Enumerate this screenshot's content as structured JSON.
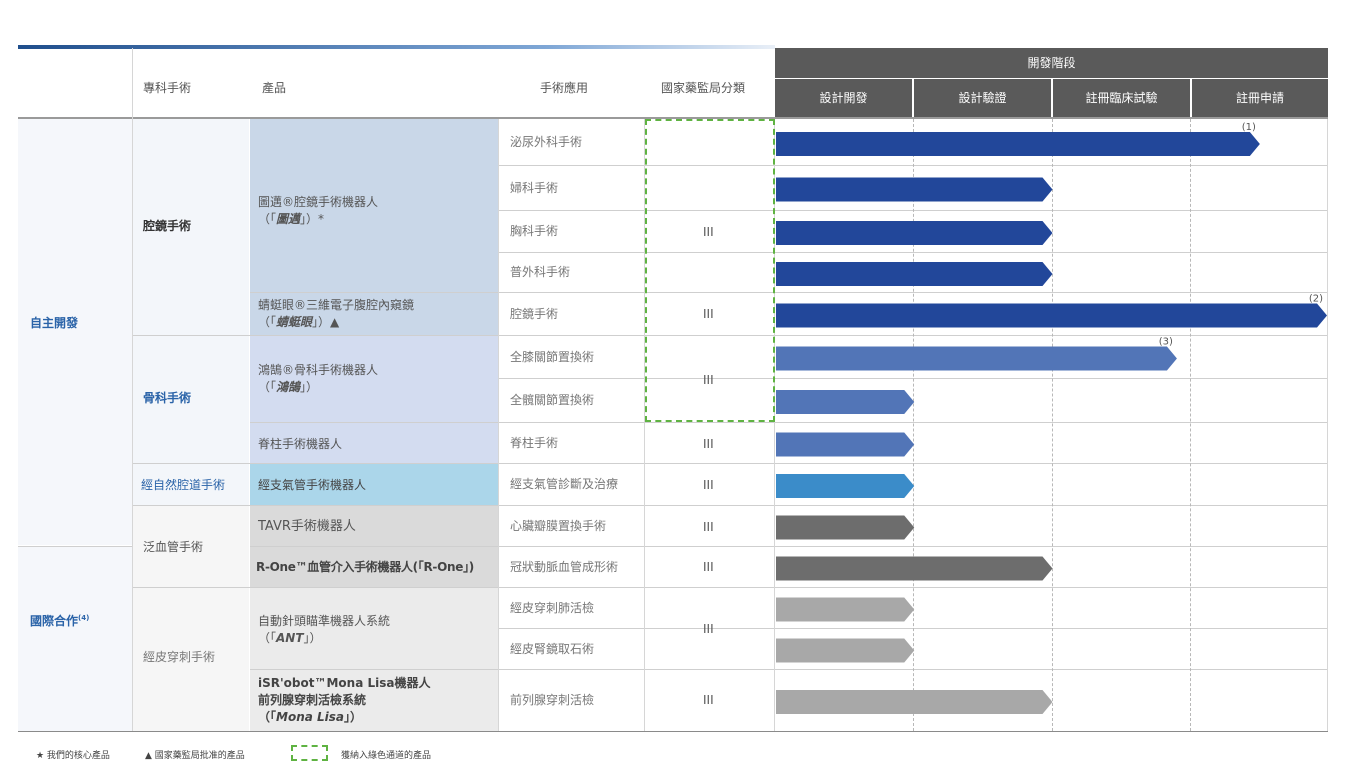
{
  "header": {
    "col_specialty": "專科手術",
    "col_product": "產品",
    "col_application": "手術應用",
    "col_nmpa": "國家藥監局分類",
    "dev_stage": "開發階段",
    "phases": [
      "設計開發",
      "設計驗證",
      "註冊臨床試驗",
      "註冊申請"
    ]
  },
  "groups": {
    "independent": "自主開發",
    "international": "國際合作",
    "international_sup": "(4)"
  },
  "specialties": {
    "laparoscopic": "腔鏡手術",
    "orthopedic": "骨科手術",
    "natural_orifice": "經自然腔道手術",
    "pan_vascular": "泛血管手術",
    "percutaneous": "經皮穿刺手術"
  },
  "products": {
    "p1_line1": "圖邁®腔鏡手術機器人",
    "p1_line2": "（「",
    "p1_name": "圖邁",
    "p1_line2_end": "」）*",
    "p2_line1": "蜻蜓眼®三維電子腹腔內窺鏡",
    "p2_line2": "（「",
    "p2_name": "蜻蜓眼",
    "p2_line2_end": "」）▲",
    "p3_line1": "鴻鵠®骨科手術機器人",
    "p3_line2": "（「",
    "p3_name": "鴻鵠",
    "p3_line2_end": "」）",
    "p4": "脊柱手術機器人",
    "p5": "經支氣管手術機器人",
    "p6": "TAVR手術機器人",
    "p7": "R-One™血管介入手術機器人(「R-One」)",
    "p8_line1": "自動針頭瞄準機器人系統",
    "p8_line2": "（「",
    "p8_name": "ANT",
    "p8_line2_end": "」）",
    "p9_line1": "iSR'obot™Mona Lisa機器人",
    "p9_line2": "前列腺穿刺活檢系統",
    "p9_line3": "（「",
    "p9_name": "Mona Lisa",
    "p9_line3_end": "」）"
  },
  "applications": [
    "泌尿外科手術",
    "婦科手術",
    "胸科手術",
    "普外科手術",
    "腔鏡手術",
    "全膝關節置換術",
    "全髖關節置換術",
    "脊柱手術",
    "經支氣管診斷及治療",
    "心臟瓣膜置換手術",
    "冠狀動脈血管成形術",
    "經皮穿刺肺活檢",
    "經皮腎鏡取石術",
    "前列腺穿刺活檢"
  ],
  "nmpa_class": "III",
  "chart_data": {
    "type": "gantt",
    "phases": [
      "設計開發",
      "設計驗證",
      "註冊臨床試驗",
      "註冊申請"
    ],
    "bars": [
      {
        "application": "泌尿外科手術",
        "progress_phases": 3.5,
        "color": "#22479a",
        "note": "(1)"
      },
      {
        "application": "婦科手術",
        "progress_phases": 2.0,
        "color": "#22479a"
      },
      {
        "application": "胸科手術",
        "progress_phases": 2.0,
        "color": "#22479a"
      },
      {
        "application": "普外科手術",
        "progress_phases": 2.0,
        "color": "#22479a"
      },
      {
        "application": "腔鏡手術",
        "progress_phases": 4.0,
        "color": "#22479a",
        "note": "(2)"
      },
      {
        "application": "全膝關節置換術",
        "progress_phases": 2.9,
        "color": "#5275b7",
        "note": "(3)"
      },
      {
        "application": "全髖關節置換術",
        "progress_phases": 1.0,
        "color": "#5275b7"
      },
      {
        "application": "脊柱手術",
        "progress_phases": 1.0,
        "color": "#5275b7"
      },
      {
        "application": "經支氣管診斷及治療",
        "progress_phases": 1.0,
        "color": "#3b8cc9"
      },
      {
        "application": "心臟瓣膜置換手術",
        "progress_phases": 1.0,
        "color": "#6d6d6d"
      },
      {
        "application": "冠狀動脈血管成形術",
        "progress_phases": 2.0,
        "color": "#6d6d6d"
      },
      {
        "application": "經皮穿刺肺活檢",
        "progress_phases": 1.0,
        "color": "#a8a8a8"
      },
      {
        "application": "經皮腎鏡取石術",
        "progress_phases": 1.0,
        "color": "#a8a8a8"
      },
      {
        "application": "前列腺穿刺活檢",
        "progress_phases": 2.0,
        "color": "#a8a8a8"
      }
    ]
  },
  "legend": {
    "core": "★ 我們的核心產品",
    "approved": "▲ 國家藥監局批准的產品",
    "green": "獲納入綠色通道的產品"
  }
}
